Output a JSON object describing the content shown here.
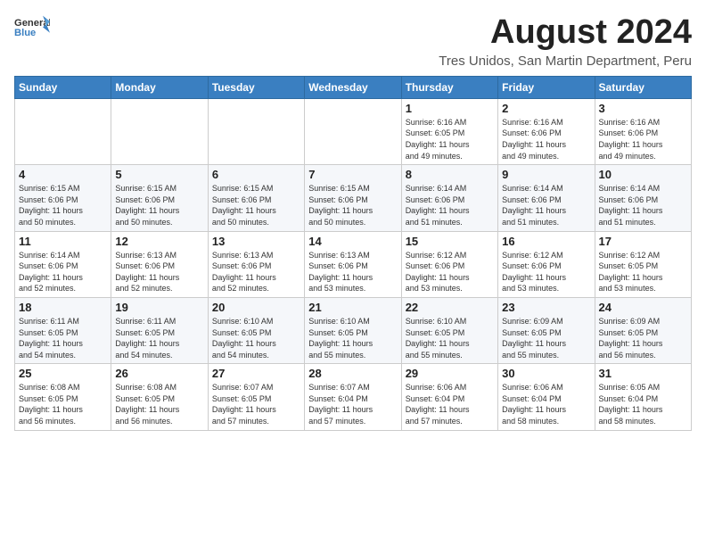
{
  "logo": {
    "general": "General",
    "blue": "Blue"
  },
  "title": "August 2024",
  "location": "Tres Unidos, San Martin Department, Peru",
  "days_of_week": [
    "Sunday",
    "Monday",
    "Tuesday",
    "Wednesday",
    "Thursday",
    "Friday",
    "Saturday"
  ],
  "weeks": [
    [
      {
        "day": "",
        "info": ""
      },
      {
        "day": "",
        "info": ""
      },
      {
        "day": "",
        "info": ""
      },
      {
        "day": "",
        "info": ""
      },
      {
        "day": "1",
        "info": "Sunrise: 6:16 AM\nSunset: 6:05 PM\nDaylight: 11 hours\nand 49 minutes."
      },
      {
        "day": "2",
        "info": "Sunrise: 6:16 AM\nSunset: 6:06 PM\nDaylight: 11 hours\nand 49 minutes."
      },
      {
        "day": "3",
        "info": "Sunrise: 6:16 AM\nSunset: 6:06 PM\nDaylight: 11 hours\nand 49 minutes."
      }
    ],
    [
      {
        "day": "4",
        "info": "Sunrise: 6:15 AM\nSunset: 6:06 PM\nDaylight: 11 hours\nand 50 minutes."
      },
      {
        "day": "5",
        "info": "Sunrise: 6:15 AM\nSunset: 6:06 PM\nDaylight: 11 hours\nand 50 minutes."
      },
      {
        "day": "6",
        "info": "Sunrise: 6:15 AM\nSunset: 6:06 PM\nDaylight: 11 hours\nand 50 minutes."
      },
      {
        "day": "7",
        "info": "Sunrise: 6:15 AM\nSunset: 6:06 PM\nDaylight: 11 hours\nand 50 minutes."
      },
      {
        "day": "8",
        "info": "Sunrise: 6:14 AM\nSunset: 6:06 PM\nDaylight: 11 hours\nand 51 minutes."
      },
      {
        "day": "9",
        "info": "Sunrise: 6:14 AM\nSunset: 6:06 PM\nDaylight: 11 hours\nand 51 minutes."
      },
      {
        "day": "10",
        "info": "Sunrise: 6:14 AM\nSunset: 6:06 PM\nDaylight: 11 hours\nand 51 minutes."
      }
    ],
    [
      {
        "day": "11",
        "info": "Sunrise: 6:14 AM\nSunset: 6:06 PM\nDaylight: 11 hours\nand 52 minutes."
      },
      {
        "day": "12",
        "info": "Sunrise: 6:13 AM\nSunset: 6:06 PM\nDaylight: 11 hours\nand 52 minutes."
      },
      {
        "day": "13",
        "info": "Sunrise: 6:13 AM\nSunset: 6:06 PM\nDaylight: 11 hours\nand 52 minutes."
      },
      {
        "day": "14",
        "info": "Sunrise: 6:13 AM\nSunset: 6:06 PM\nDaylight: 11 hours\nand 53 minutes."
      },
      {
        "day": "15",
        "info": "Sunrise: 6:12 AM\nSunset: 6:06 PM\nDaylight: 11 hours\nand 53 minutes."
      },
      {
        "day": "16",
        "info": "Sunrise: 6:12 AM\nSunset: 6:06 PM\nDaylight: 11 hours\nand 53 minutes."
      },
      {
        "day": "17",
        "info": "Sunrise: 6:12 AM\nSunset: 6:05 PM\nDaylight: 11 hours\nand 53 minutes."
      }
    ],
    [
      {
        "day": "18",
        "info": "Sunrise: 6:11 AM\nSunset: 6:05 PM\nDaylight: 11 hours\nand 54 minutes."
      },
      {
        "day": "19",
        "info": "Sunrise: 6:11 AM\nSunset: 6:05 PM\nDaylight: 11 hours\nand 54 minutes."
      },
      {
        "day": "20",
        "info": "Sunrise: 6:10 AM\nSunset: 6:05 PM\nDaylight: 11 hours\nand 54 minutes."
      },
      {
        "day": "21",
        "info": "Sunrise: 6:10 AM\nSunset: 6:05 PM\nDaylight: 11 hours\nand 55 minutes."
      },
      {
        "day": "22",
        "info": "Sunrise: 6:10 AM\nSunset: 6:05 PM\nDaylight: 11 hours\nand 55 minutes."
      },
      {
        "day": "23",
        "info": "Sunrise: 6:09 AM\nSunset: 6:05 PM\nDaylight: 11 hours\nand 55 minutes."
      },
      {
        "day": "24",
        "info": "Sunrise: 6:09 AM\nSunset: 6:05 PM\nDaylight: 11 hours\nand 56 minutes."
      }
    ],
    [
      {
        "day": "25",
        "info": "Sunrise: 6:08 AM\nSunset: 6:05 PM\nDaylight: 11 hours\nand 56 minutes."
      },
      {
        "day": "26",
        "info": "Sunrise: 6:08 AM\nSunset: 6:05 PM\nDaylight: 11 hours\nand 56 minutes."
      },
      {
        "day": "27",
        "info": "Sunrise: 6:07 AM\nSunset: 6:05 PM\nDaylight: 11 hours\nand 57 minutes."
      },
      {
        "day": "28",
        "info": "Sunrise: 6:07 AM\nSunset: 6:04 PM\nDaylight: 11 hours\nand 57 minutes."
      },
      {
        "day": "29",
        "info": "Sunrise: 6:06 AM\nSunset: 6:04 PM\nDaylight: 11 hours\nand 57 minutes."
      },
      {
        "day": "30",
        "info": "Sunrise: 6:06 AM\nSunset: 6:04 PM\nDaylight: 11 hours\nand 58 minutes."
      },
      {
        "day": "31",
        "info": "Sunrise: 6:05 AM\nSunset: 6:04 PM\nDaylight: 11 hours\nand 58 minutes."
      }
    ]
  ]
}
